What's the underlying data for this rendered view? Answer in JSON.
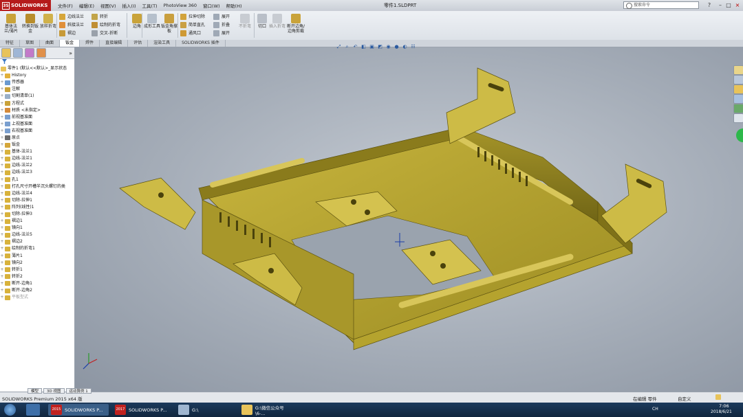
{
  "app": {
    "brand": "SOLIDWORKS",
    "window_title": "零件1.SLDPRT"
  },
  "menu": [
    "文件(F)",
    "编辑(E)",
    "视图(V)",
    "插入(I)",
    "工具(T)",
    "PhotoView 360",
    "窗口(W)",
    "帮助(H)"
  ],
  "search": {
    "placeholder": "搜索命令"
  },
  "ribbon": {
    "big": [
      "基体法兰/薄片",
      "转换到钣金",
      "放样折弯"
    ],
    "small_col1": [
      "边线法兰",
      "斜接法兰",
      "褶边"
    ],
    "small_col2": [
      "转折",
      "绘制的折弯",
      "交叉-折断"
    ],
    "big2": [
      "边角",
      "成形工具",
      "钣金角撑板"
    ],
    "small_col3": [
      "拉伸切除",
      "简单直孔",
      "通风口"
    ],
    "small_col4": [
      "展开",
      "折叠",
      "展开"
    ],
    "big3": [
      "不折弯",
      "切口",
      "插入折弯",
      "断开边角/边角剪裁"
    ]
  },
  "tabs": [
    "特征",
    "草图",
    "曲面",
    "钣金",
    "焊件",
    "直接编辑",
    "评估",
    "渲染工具",
    "SOLIDWORKS 插件"
  ],
  "active_tab": "钣金",
  "tree": {
    "root": "零件1 (默认<<默认>_显示状态",
    "items": [
      "History",
      "传感器",
      "注解",
      "切割清单(1)",
      "方程式",
      "材质 <未指定>",
      "前视基准面",
      "上视基准面",
      "右视基准面",
      "原点",
      "钣金",
      "基体-法兰1",
      "边线-法兰1",
      "边线-法兰2",
      "边线-法兰3",
      "孔1",
      "打孔尺寸开槽半沉头螺钉的类",
      "边线-法兰4",
      "切除-拉伸1",
      "阵列(线性)1",
      "切除-拉伸3",
      "褶边1",
      "镜向1",
      "边线-法兰5",
      "褶边2",
      "绘制的折弯1",
      "薄片1",
      "镜向2",
      "转折1",
      "转折2",
      "断开-边角1",
      "断开-边角2",
      "平板型式"
    ]
  },
  "bottom_tabs": [
    "模型",
    "3D 视图",
    "运动算例 1"
  ],
  "status": {
    "left": "SOLIDWORKS Premium 2015 x64 版",
    "mode": "在编辑 零件",
    "custom": "自定义"
  },
  "taskbar": {
    "items": [
      "SOLIDWORKS P...",
      "SOLIDWORKS P...",
      "G:\\",
      "G:\\微信公众号\\6-..."
    ],
    "badges": [
      "2015",
      "2017"
    ],
    "lang": "CH",
    "time": "7:06",
    "date": "2018/6/21"
  },
  "colors": {
    "part": "#b5a32e",
    "part_dark": "#6e6315",
    "part_light": "#e3d46a",
    "accent": "#b51b1b"
  }
}
